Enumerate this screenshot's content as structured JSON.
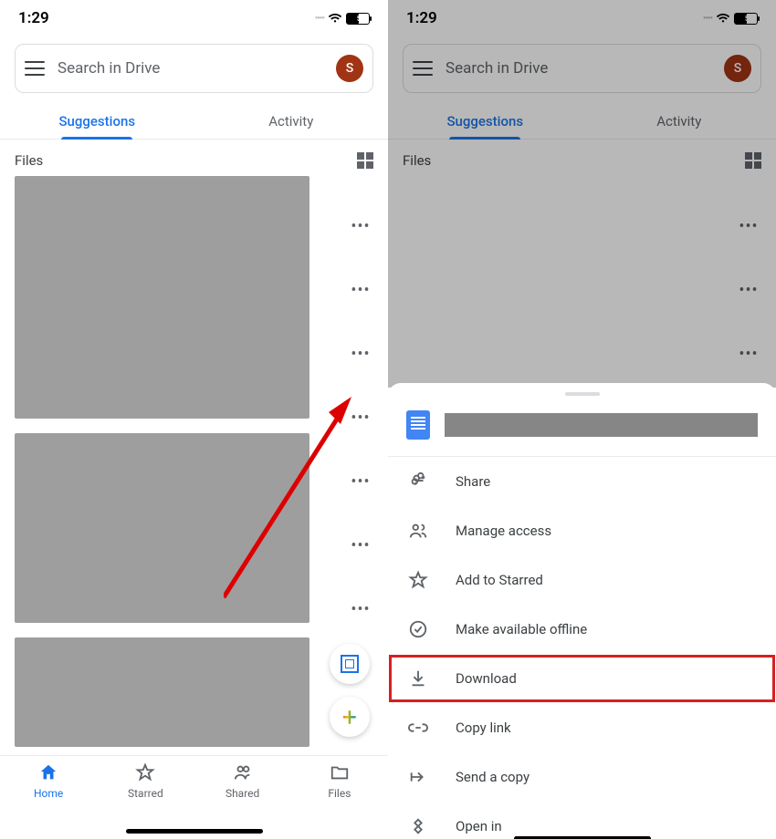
{
  "status": {
    "time": "1:29",
    "battery": "53"
  },
  "search": {
    "placeholder": "Search in Drive",
    "avatar_initial": "S"
  },
  "tabs": {
    "suggestions": "Suggestions",
    "activity": "Activity"
  },
  "files_header": {
    "label": "Files"
  },
  "bottom_nav": {
    "home": "Home",
    "starred": "Starred",
    "shared": "Shared",
    "files": "Files"
  },
  "sheet": {
    "items": [
      {
        "label": "Share"
      },
      {
        "label": "Manage access"
      },
      {
        "label": "Add to Starred"
      },
      {
        "label": "Make available offline"
      },
      {
        "label": "Download"
      },
      {
        "label": "Copy link"
      },
      {
        "label": "Send a copy"
      },
      {
        "label": "Open in"
      }
    ]
  }
}
